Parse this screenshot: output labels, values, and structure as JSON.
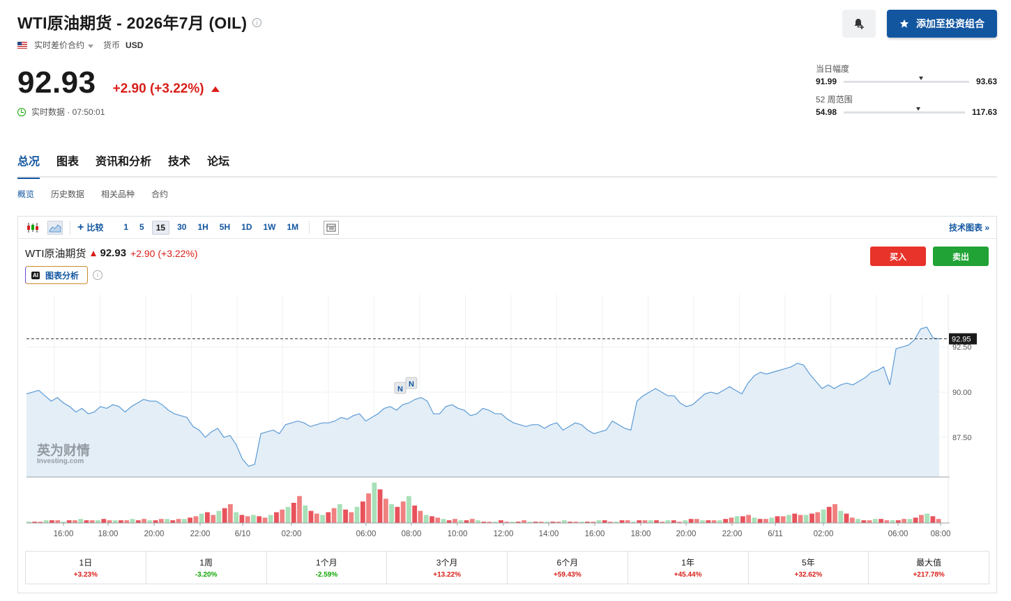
{
  "header": {
    "title": "WTI原油期货 - 2026年7月 (OIL)",
    "contract_type": "实时差价合约",
    "currency_label": "货币",
    "currency": "USD",
    "price": "92.93",
    "change": "+2.90 (+3.22%)",
    "realtime_label": "实时数据 · 07:50:01",
    "add_button": "添加至投资组合"
  },
  "ranges": {
    "day": {
      "label": "当日幅度",
      "low": "91.99",
      "high": "93.63",
      "position": 0.6
    },
    "week52": {
      "label": "52 周范围",
      "low": "54.98",
      "high": "117.63",
      "position": 0.6
    }
  },
  "tabs": [
    "总况",
    "图表",
    "资讯和分析",
    "技术",
    "论坛"
  ],
  "subtabs": [
    "概览",
    "历史数据",
    "相关品种",
    "合约"
  ],
  "toolbar": {
    "compare": "比较",
    "intervals": [
      "1",
      "5",
      "15",
      "30",
      "1H",
      "5H",
      "1D",
      "1W",
      "1M"
    ],
    "active_interval": "15",
    "tech_chart": "技术图表 »"
  },
  "legend": {
    "name": "WTI原油期货",
    "price": "92.93",
    "change": "+2.90 (+3.22%)"
  },
  "ai_button": "图表分析",
  "buy_label": "买入",
  "sell_label": "卖出",
  "watermark": {
    "cn": "英为财情",
    "en": "Investing.com"
  },
  "chart_data": {
    "type": "area",
    "y_ticks": [
      "92.50",
      "90.00",
      "87.50"
    ],
    "last_price_label": "92.95",
    "last_price": 92.95,
    "ylim": [
      85.3,
      95.4
    ],
    "x_labels": [
      "16:00",
      "18:00",
      "20:00",
      "22:00",
      "6/10",
      "02:00",
      "06:00",
      "08:00",
      "10:00",
      "12:00",
      "14:00",
      "16:00",
      "18:00",
      "20:00",
      "22:00",
      "6/11",
      "02:00",
      "06:00",
      "08:00"
    ],
    "line_color": "#5b9bd5",
    "fill_color": "#e4eef7",
    "news_markers": [
      "N",
      "N"
    ],
    "series": [
      89.9,
      90.0,
      90.1,
      89.8,
      89.5,
      89.7,
      89.4,
      89.2,
      88.9,
      89.1,
      88.8,
      88.9,
      89.2,
      89.1,
      89.3,
      89.2,
      88.9,
      89.2,
      89.4,
      89.6,
      89.5,
      89.5,
      89.3,
      89.0,
      88.8,
      88.7,
      88.6,
      88.1,
      87.9,
      87.5,
      87.8,
      88.0,
      87.5,
      87.6,
      87.1,
      86.3,
      85.9,
      86.0,
      87.7,
      87.8,
      87.9,
      87.7,
      88.2,
      88.3,
      88.4,
      88.3,
      88.1,
      88.2,
      88.3,
      88.3,
      88.4,
      88.6,
      88.5,
      88.7,
      88.8,
      88.4,
      88.6,
      88.8,
      89.1,
      89.2,
      89.0,
      89.3,
      89.4,
      89.6,
      89.7,
      89.5,
      88.8,
      88.8,
      89.2,
      89.3,
      89.1,
      89.0,
      88.7,
      88.8,
      89.1,
      89.0,
      88.8,
      88.8,
      88.5,
      88.3,
      88.2,
      88.1,
      88.2,
      88.2,
      88.0,
      88.2,
      88.3,
      87.9,
      88.1,
      88.3,
      88.2,
      87.9,
      87.7,
      87.8,
      87.9,
      88.4,
      88.2,
      88.0,
      87.9,
      89.5,
      89.8,
      90.0,
      90.2,
      90.0,
      89.8,
      89.8,
      89.4,
      89.2,
      89.3,
      89.6,
      89.9,
      90.0,
      89.9,
      90.1,
      90.3,
      90.1,
      89.9,
      90.5,
      90.9,
      91.1,
      91.0,
      91.1,
      91.2,
      91.3,
      91.4,
      91.6,
      91.5,
      91.0,
      90.6,
      90.2,
      90.4,
      90.2,
      90.4,
      90.5,
      90.4,
      90.6,
      90.8,
      91.1,
      91.2,
      91.4,
      90.4,
      92.4,
      92.5,
      92.6,
      92.9,
      93.5,
      93.6,
      93.0,
      92.95
    ]
  },
  "volume_data": {
    "values": [
      1,
      1,
      1,
      2,
      2,
      2,
      1,
      2,
      2,
      3,
      2,
      2,
      2,
      3,
      2,
      2,
      2,
      2,
      3,
      2,
      3,
      2,
      2,
      3,
      3,
      2,
      3,
      3,
      4,
      5,
      7,
      8,
      6,
      9,
      11,
      14,
      8,
      6,
      5,
      6,
      5,
      4,
      6,
      8,
      10,
      12,
      15,
      20,
      13,
      9,
      7,
      6,
      8,
      11,
      14,
      10,
      8,
      12,
      16,
      22,
      30,
      25,
      18,
      14,
      12,
      16,
      20,
      13,
      9,
      6,
      5,
      4,
      3,
      2,
      3,
      2,
      2,
      3,
      2,
      1,
      1,
      1,
      2,
      1,
      1,
      1,
      2,
      1,
      1,
      1,
      1,
      1,
      1,
      2,
      1,
      1,
      1,
      1,
      1,
      2,
      2,
      1,
      1,
      2,
      2,
      1,
      2,
      2,
      2,
      2,
      1,
      2,
      2,
      1,
      2,
      3,
      3,
      2,
      2,
      2,
      2,
      3,
      4,
      5,
      5,
      6,
      4,
      3,
      3,
      4,
      5,
      5,
      6,
      7,
      6,
      6,
      7,
      8,
      10,
      12,
      14,
      9,
      7,
      4,
      3,
      2,
      2,
      3,
      3,
      2,
      2,
      2,
      3,
      3,
      4,
      6,
      7,
      5,
      3
    ],
    "colors": [
      "#a8e0b8",
      "#f08080",
      "#e8525b",
      "#7bd49a"
    ]
  },
  "performance": [
    {
      "label": "1日",
      "value": "+3.23%",
      "dir": "up"
    },
    {
      "label": "1周",
      "value": "-3.20%",
      "dir": "down"
    },
    {
      "label": "1个月",
      "value": "-2.59%",
      "dir": "down"
    },
    {
      "label": "3个月",
      "value": "+13.22%",
      "dir": "up"
    },
    {
      "label": "6个月",
      "value": "+59.43%",
      "dir": "up"
    },
    {
      "label": "1年",
      "value": "+45.44%",
      "dir": "up"
    },
    {
      "label": "5年",
      "value": "+32.62%",
      "dir": "up"
    },
    {
      "label": "最大值",
      "value": "+217.78%",
      "dir": "up"
    }
  ]
}
